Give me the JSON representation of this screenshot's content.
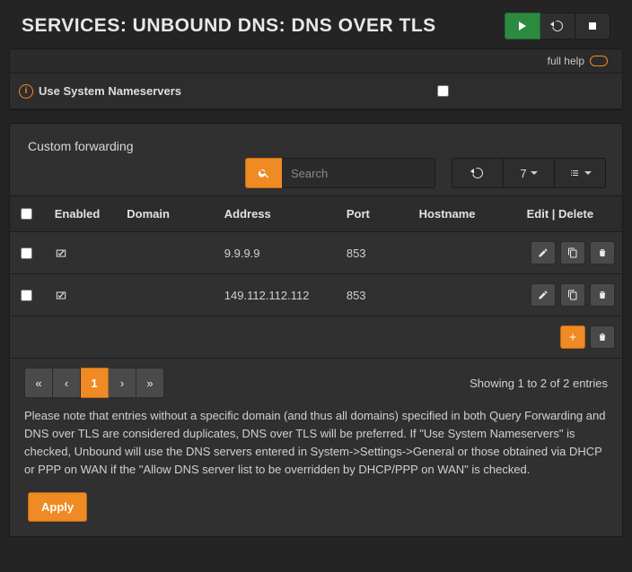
{
  "header": {
    "title": "SERVICES: UNBOUND DNS: DNS OVER TLS"
  },
  "help": {
    "full_help_label": "full help"
  },
  "nameservers": {
    "label": "Use System Nameservers",
    "checked": false
  },
  "table": {
    "section_title": "Custom forwarding",
    "search_placeholder": "Search",
    "page_size": "7",
    "columns": {
      "enabled": "Enabled",
      "domain": "Domain",
      "address": "Address",
      "port": "Port",
      "hostname": "Hostname",
      "actions": "Edit | Delete"
    },
    "rows": [
      {
        "enabled": true,
        "domain": "",
        "address": "9.9.9.9",
        "port": "853",
        "hostname": ""
      },
      {
        "enabled": true,
        "domain": "",
        "address": "149.112.112.112",
        "port": "853",
        "hostname": ""
      }
    ],
    "pager": {
      "first": "«",
      "prev": "‹",
      "current": "1",
      "next": "›",
      "last": "»",
      "info": "Showing 1 to 2 of 2 entries"
    }
  },
  "note": "Please note that entries without a specific domain (and thus all domains) specified in both Query Forwarding and DNS over TLS are considered duplicates, DNS over TLS will be preferred. If \"Use System Nameservers\" is checked, Unbound will use the DNS servers entered in System->Settings->General or those obtained via DHCP or PPP on WAN if the \"Allow DNS server list to be overridden by DHCP/PPP on WAN\" is checked.",
  "apply_label": "Apply"
}
